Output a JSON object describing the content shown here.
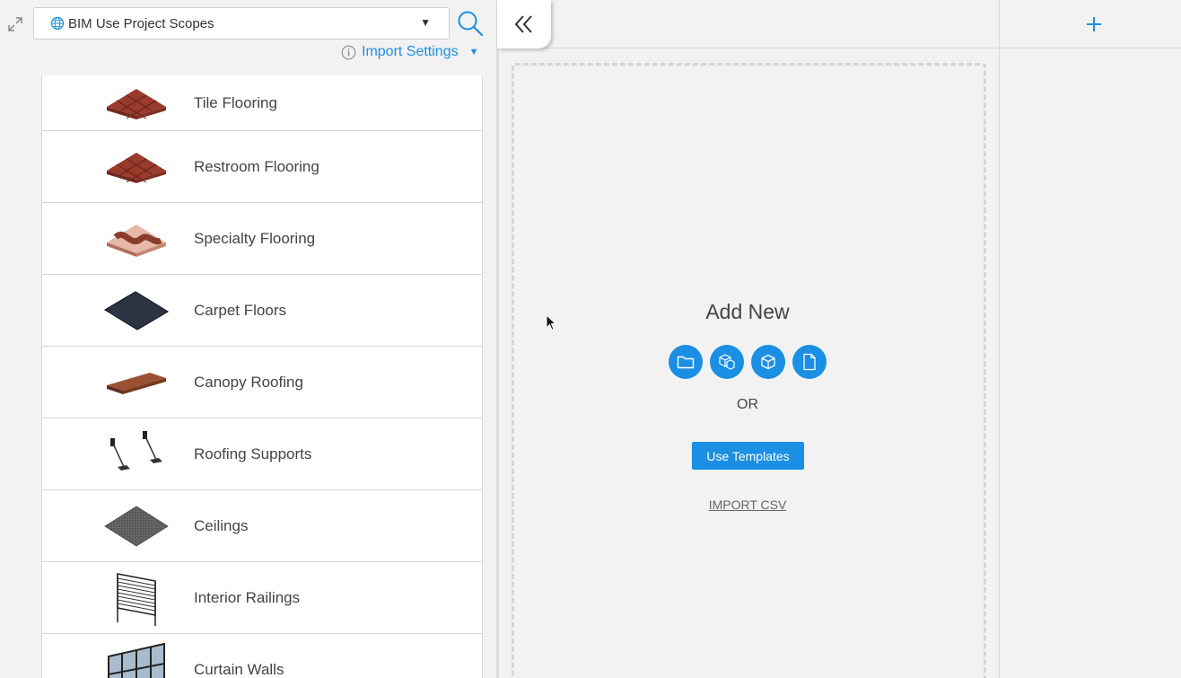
{
  "header": {
    "scope_select_value": "BIM Use Project Scopes",
    "import_settings_label": "Import Settings"
  },
  "scopes": [
    {
      "name": "Tile Flooring",
      "icon": "tile-flooring-icon"
    },
    {
      "name": "Restroom Flooring",
      "icon": "restroom-flooring-icon"
    },
    {
      "name": "Specialty Flooring",
      "icon": "specialty-flooring-icon"
    },
    {
      "name": "Carpet Floors",
      "icon": "carpet-floors-icon"
    },
    {
      "name": "Canopy Roofing",
      "icon": "canopy-roofing-icon"
    },
    {
      "name": "Roofing Supports",
      "icon": "roofing-supports-icon"
    },
    {
      "name": "Ceilings",
      "icon": "ceilings-icon"
    },
    {
      "name": "Interior Railings",
      "icon": "interior-railings-icon"
    },
    {
      "name": "Curtain Walls",
      "icon": "curtain-walls-icon"
    }
  ],
  "main": {
    "add_new_title": "Add New",
    "add_icons": [
      "folder-icon",
      "multi-cube-icon",
      "cube-icon",
      "file-icon"
    ],
    "or_text": "OR",
    "use_templates_label": "Use Templates",
    "import_csv_label": "IMPORT CSV"
  },
  "colors": {
    "accent": "#1a8fe3",
    "background": "#f2f2f2"
  }
}
